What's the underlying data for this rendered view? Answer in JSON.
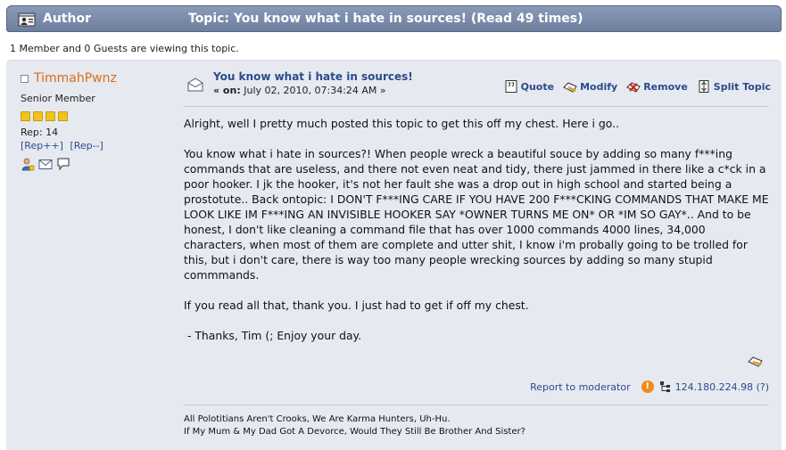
{
  "header": {
    "author_label": "Author",
    "topic_title": "Topic: You know what i hate in sources!  (Read 49 times)"
  },
  "viewers_text": "1 Member and 0 Guests are viewing this topic.",
  "poster": {
    "username": "TimmahPwnz",
    "group": "Senior Member",
    "star_count": 4,
    "rep": "Rep: 14",
    "rep_plus": "[Rep++]",
    "rep_minus": "[Rep--]"
  },
  "post": {
    "subject": "You know what i hate in sources!",
    "date_prefix": "« on:",
    "date": "July 02, 2010, 07:34:24 AM »",
    "actions": {
      "quote": "Quote",
      "modify": "Modify",
      "remove": "Remove",
      "split": "Split Topic"
    },
    "paragraphs": [
      "Alright, well I pretty much posted this topic to get this off my chest. Here i go..",
      "You know what i hate in sources?! When people wreck a beautiful souce by adding so many f***ing commands that are useless, and there not even neat and tidy, there just jammed in there like a c*ck in a poor hooker. I jk the hooker, it's not her fault she was a drop out in high school and started being a prostotute.. Back ontopic: I DON'T F***ING CARE IF YOU HAVE 200 F***CKING COMMANDS THAT MAKE ME LOOK LIKE IM F***ING AN INVISIBLE HOOKER SAY *OWNER TURNS ME ON* OR *IM SO GAY*.. And to be honest, I don't like cleaning a command file that has over 1000 commands 4000 lines, 34,000 characters, when most of them are complete and utter shit, I know i'm probally going to be trolled for this, but i don't care, there is way too many people wrecking sources by adding so many stupid commmands.",
      "If you read all that, thank you. I just had to get if off my chest.",
      " - Thanks, Tim (; Enjoy your day."
    ],
    "report_label": "Report to moderator",
    "ip_address": "124.180.224.98 (?)",
    "signature_line1": "All Polotitians Aren't Crooks, We Are Karma Hunters, Uh-Hu.",
    "signature_line2": "If My Mum & My Dad Got A Devorce, Would They Still Be Brother And Sister?"
  },
  "icons": {
    "author": "author-icon",
    "message": "message-icon",
    "quote": "quote-icon",
    "modify": "modify-icon",
    "remove": "remove-icon",
    "split": "split-icon",
    "profile": "profile-icon",
    "email": "email-icon",
    "pm": "personal-message-icon",
    "warn": "warning-icon",
    "ip": "ip-icon"
  },
  "colors": {
    "header_bg": "#7a8aaa",
    "post_bg": "#e6e9f0",
    "username": "#d96d14",
    "link": "#2b4b8c"
  }
}
